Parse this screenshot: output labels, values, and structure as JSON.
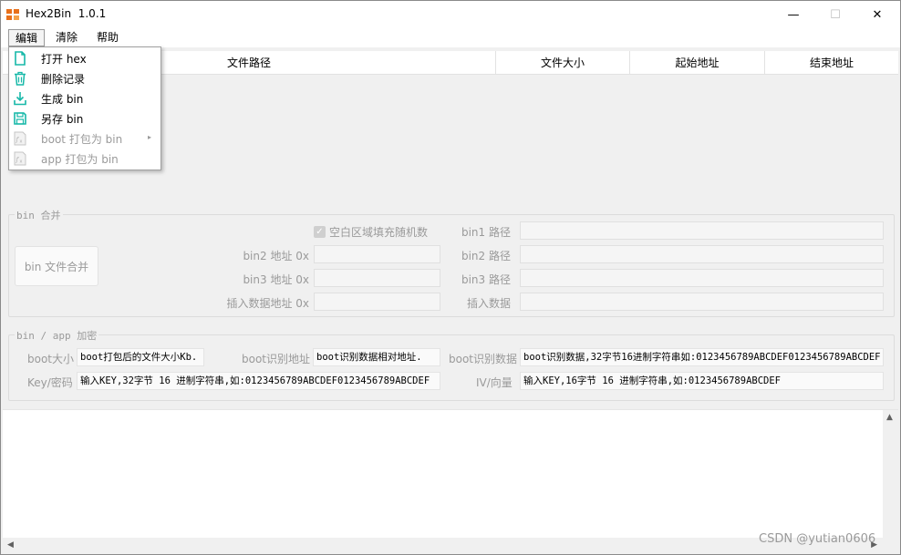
{
  "window": {
    "title": "Hex2Bin  1.0.1",
    "controls": {
      "minimize": "—",
      "maximize": "☐",
      "close": "✕"
    }
  },
  "menubar": [
    "编辑",
    "清除",
    "帮助"
  ],
  "dropdown": [
    {
      "label": "打开 hex",
      "icon": "file-icon",
      "enabled": true
    },
    {
      "label": "删除记录",
      "icon": "trash-icon",
      "enabled": true
    },
    {
      "label": "生成 bin",
      "icon": "download-icon",
      "enabled": true
    },
    {
      "label": "另存 bin",
      "icon": "save-icon",
      "enabled": true
    },
    {
      "label": "boot 打包为 bin",
      "icon": "function-icon",
      "enabled": false,
      "submenu": "▸"
    },
    {
      "label": "app  打包为 bin",
      "icon": "function-icon",
      "enabled": false
    }
  ],
  "table": {
    "columns": [
      "文件路径",
      "文件大小",
      "起始地址",
      "结束地址"
    ]
  },
  "merge": {
    "title": "bin 合并",
    "button": "bin 文件合并",
    "random_fill": "空白区域填充随机数",
    "bin2_addr": "bin2 地址 0x",
    "bin3_addr": "bin3 地址 0x",
    "insert_addr": "插入数据地址 0x",
    "bin1_path": "bin1 路径",
    "bin2_path": "bin2 路径",
    "bin3_path": "bin3 路径",
    "insert_data": "插入数据"
  },
  "encrypt": {
    "title": "bin / app 加密",
    "boot_size_label": "boot大小",
    "boot_size_value": "boot打包后的文件大小Kb.",
    "boot_addr_label": "boot识别地址",
    "boot_addr_value": "boot识别数据相对地址.",
    "boot_data_label": "boot识别数据",
    "boot_data_value": "boot识别数据,32字节16进制字符串如:0123456789ABCDEF0123456789ABCDEF",
    "key_label": "Key/密码",
    "key_value": "输入KEY,32字节 16 进制字符串,如:0123456789ABCDEF0123456789ABCDEF",
    "iv_label": "IV/向量",
    "iv_value": "输入KEY,16字节 16 进制字符串,如:0123456789ABCDEF"
  },
  "watermark": "CSDN @yutian0606",
  "colors": {
    "accent": "#16b8a8",
    "icon_orange": "#e8701a",
    "disabled_text": "#9a9a9a"
  }
}
